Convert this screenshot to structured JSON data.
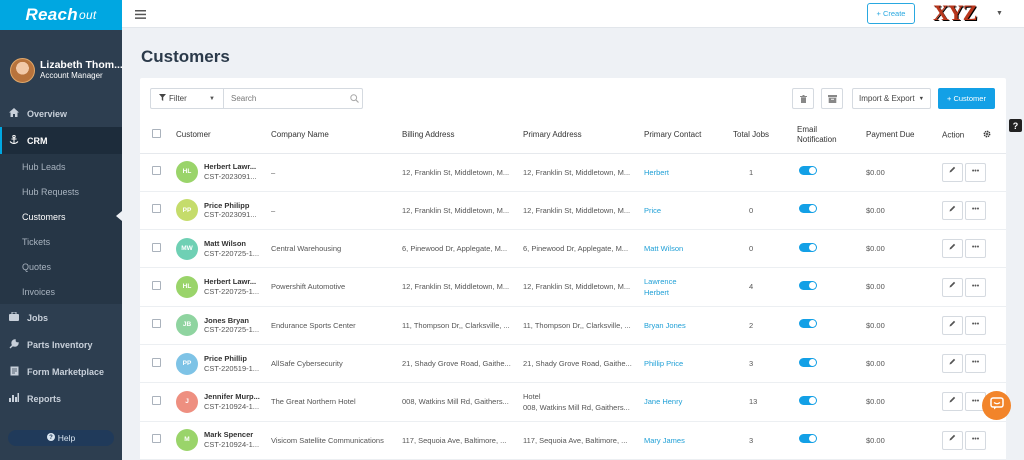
{
  "brand": {
    "name": "Reach",
    "suffix": "out"
  },
  "user": {
    "name": "Lizabeth Thom...",
    "role": "Account Manager"
  },
  "nav": {
    "overview": "Overview",
    "crm": "CRM",
    "crm_sub": [
      "Hub Leads",
      "Hub Requests",
      "Customers",
      "Tickets",
      "Quotes",
      "Invoices"
    ],
    "jobs": "Jobs",
    "parts": "Parts Inventory",
    "forms": "Form Marketplace",
    "reports": "Reports",
    "help": "Help"
  },
  "topbar": {
    "create": "+ Create",
    "logo": "XYZ"
  },
  "page": {
    "title": "Customers"
  },
  "toolbar": {
    "filter": "Filter",
    "search_placeholder": "Search",
    "import_export": "Import & Export",
    "add_customer": "+ Customer"
  },
  "table": {
    "headers": {
      "customer": "Customer",
      "company": "Company Name",
      "billing": "Billing Address",
      "primary": "Primary Address",
      "contact": "Primary Contact",
      "jobs": "Total Jobs",
      "email1": "Email",
      "email2": "Notification",
      "payment": "Payment Due",
      "action": "Action"
    },
    "rows": [
      {
        "initials": "HL",
        "color": "#9ad46a",
        "name": "Herbert Lawr...",
        "id": "CST-2023091...",
        "company": "–",
        "billing": "12, Franklin St, Middletown, M...",
        "primary1": "12, Franklin St, Middletown, M...",
        "primary2": "",
        "contact1": "Herbert",
        "contact2": "",
        "jobs": "1",
        "payment": "$0.00"
      },
      {
        "initials": "PP",
        "color": "#c5dc6b",
        "name": "Price Philipp",
        "id": "CST-2023091...",
        "company": "–",
        "billing": "12, Franklin St, Middletown, M...",
        "primary1": "12, Franklin St, Middletown, M...",
        "primary2": "",
        "contact1": "Price",
        "contact2": "",
        "jobs": "0",
        "payment": "$0.00"
      },
      {
        "initials": "MW",
        "color": "#6fd0b4",
        "name": "Matt Wilson",
        "id": "CST-220725-1...",
        "company": "Central Warehousing",
        "billing": "6, Pinewood Dr, Applegate, M...",
        "primary1": "6, Pinewood Dr, Applegate, M...",
        "primary2": "",
        "contact1": "Matt Wilson",
        "contact2": "",
        "jobs": "0",
        "payment": "$0.00"
      },
      {
        "initials": "HL",
        "color": "#9ad46a",
        "name": "Herbert Lawr...",
        "id": "CST-220725-1...",
        "company": "Powershift Automotive",
        "billing": "12, Franklin St, Middletown, M...",
        "primary1": "12, Franklin St, Middletown, M...",
        "primary2": "",
        "contact1": "Lawrence",
        "contact2": "Herbert",
        "jobs": "4",
        "payment": "$0.00"
      },
      {
        "initials": "JB",
        "color": "#8fd4a0",
        "name": "Jones Bryan",
        "id": "CST-220725-1...",
        "company": "Endurance Sports Center",
        "billing": "11, Thompson Dr,, Clarksville, ...",
        "primary1": "11, Thompson Dr,, Clarksville, ...",
        "primary2": "",
        "contact1": "Bryan Jones",
        "contact2": "",
        "jobs": "2",
        "payment": "$0.00"
      },
      {
        "initials": "PP",
        "color": "#7ec3e6",
        "name": "Price Phillip",
        "id": "CST-220519-1...",
        "company": "AllSafe Cybersecurity",
        "billing": "21, Shady Grove Road, Gaithe...",
        "primary1": "21, Shady Grove Road, Gaithe...",
        "primary2": "",
        "contact1": "Phillip Price",
        "contact2": "",
        "jobs": "3",
        "payment": "$0.00"
      },
      {
        "initials": "J",
        "color": "#ee8f80",
        "name": "Jennifer Murp...",
        "id": "CST-210924-1...",
        "company": "The Great Northern Hotel",
        "billing": "008, Watkins Mill Rd, Gaithers...",
        "primary1": "Hotel",
        "primary2": "008, Watkins Mill Rd, Gaithers...",
        "contact1": "Jane Henry",
        "contact2": "",
        "jobs": "13",
        "payment": "$0.00"
      },
      {
        "initials": "M",
        "color": "#9ad46a",
        "name": "Mark Spencer",
        "id": "CST-210924-1...",
        "company": "Visicom Satellite Communications",
        "billing": "117, Sequoia Ave, Baltimore, ...",
        "primary1": "117, Sequoia Ave, Baltimore, ...",
        "primary2": "",
        "contact1": "Mary James",
        "contact2": "",
        "jobs": "3",
        "payment": "$0.00"
      }
    ]
  }
}
